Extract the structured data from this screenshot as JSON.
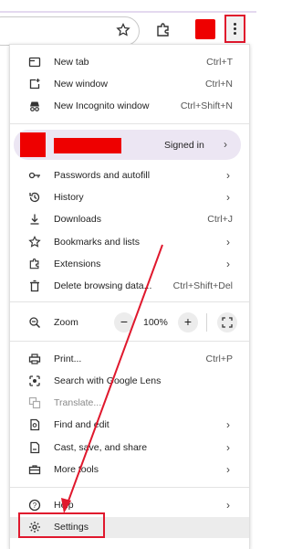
{
  "menu": {
    "new_tab": {
      "label": "New tab",
      "shortcut": "Ctrl+T"
    },
    "new_window": {
      "label": "New window",
      "shortcut": "Ctrl+N"
    },
    "new_incognito": {
      "label": "New Incognito window",
      "shortcut": "Ctrl+Shift+N"
    },
    "profile": {
      "status": "Signed in"
    },
    "passwords": {
      "label": "Passwords and autofill"
    },
    "history": {
      "label": "History"
    },
    "downloads": {
      "label": "Downloads",
      "shortcut": "Ctrl+J"
    },
    "bookmarks": {
      "label": "Bookmarks and lists"
    },
    "extensions": {
      "label": "Extensions"
    },
    "delete_data": {
      "label": "Delete browsing data...",
      "shortcut": "Ctrl+Shift+Del"
    },
    "zoom": {
      "label": "Zoom",
      "minus": "−",
      "value": "100%",
      "plus": "+"
    },
    "print": {
      "label": "Print...",
      "shortcut": "Ctrl+P"
    },
    "lens": {
      "label": "Search with Google Lens"
    },
    "translate": {
      "label": "Translate..."
    },
    "find_edit": {
      "label": "Find and edit"
    },
    "cast_save": {
      "label": "Cast, save, and share"
    },
    "more_tools": {
      "label": "More tools"
    },
    "help": {
      "label": "Help"
    },
    "settings": {
      "label": "Settings"
    }
  },
  "colors": {
    "annotation": "#e0182d",
    "profile_red": "#ee0000",
    "profile_bg": "#ece6f3"
  },
  "icons": [
    "star-icon",
    "extensions-icon",
    "more-menu-icon",
    "new-tab-icon",
    "new-window-icon",
    "incognito-icon",
    "key-icon",
    "history-icon",
    "download-icon",
    "star-icon",
    "extension-icon",
    "trash-icon",
    "zoom-icon",
    "fullscreen-icon",
    "print-icon",
    "lens-icon",
    "translate-icon",
    "find-icon",
    "cast-icon",
    "toolbox-icon",
    "help-icon",
    "gear-icon"
  ]
}
